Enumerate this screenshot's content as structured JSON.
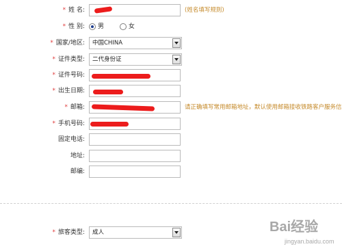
{
  "form": {
    "name": {
      "label": "姓  名:",
      "hint": "(姓名填写规则)"
    },
    "gender": {
      "label": "性  别:",
      "options": [
        "男",
        "女"
      ],
      "selected": "男"
    },
    "country": {
      "label": "国家/地区:",
      "value": "中国CHINA"
    },
    "id_type": {
      "label": "证件类型:",
      "value": "二代身份证"
    },
    "id_number": {
      "label": "证件号码:"
    },
    "birth_date": {
      "label": "出生日期:"
    },
    "email": {
      "label": "邮箱:",
      "hint": "请正确填写常用邮箱地址，默认使用邮箱接收铁路客户服务信息"
    },
    "mobile": {
      "label": "手机号码:"
    },
    "phone": {
      "label": "固定电话:"
    },
    "address": {
      "label": "地址:"
    },
    "postcode": {
      "label": "邮编:"
    },
    "passenger_type": {
      "label": "旅客类型:",
      "value": "成人"
    }
  },
  "required_mark": "*",
  "colors": {
    "required": "#e03c3c",
    "hint": "#c58a2a",
    "redaction": "#ec1c1c"
  },
  "watermark": {
    "text": "Bai经验",
    "sub": "jingyan.baidu.com"
  }
}
